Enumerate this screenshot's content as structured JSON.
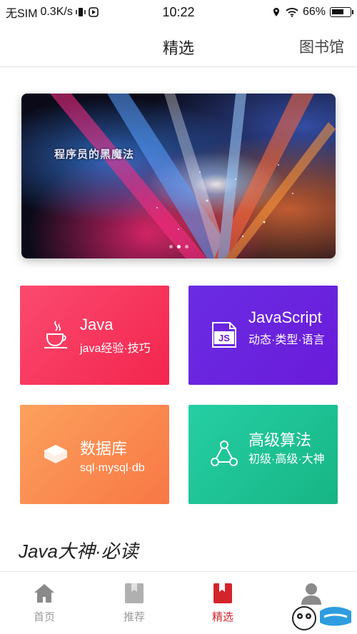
{
  "status_bar": {
    "carrier": "无SIM",
    "speed": "0.3K/s",
    "time": "10:22",
    "battery": "66%",
    "battery_level": 0.66
  },
  "header": {
    "title": "精选",
    "library_link": "图书馆"
  },
  "banner": {
    "text": "程序员的黑魔法",
    "slides": 3,
    "active_slide": 1
  },
  "categories": [
    {
      "name": "Java",
      "desc": "java经验·技巧",
      "icon": "java-cup-icon",
      "color": "#f3254e"
    },
    {
      "name": "JavaScript",
      "desc": "动态·类型·语言",
      "icon": "js-icon",
      "color": "#6a1bd9"
    },
    {
      "name": "数据库",
      "desc": "sql·mysql·db",
      "icon": "database-icon",
      "color": "#f87744"
    },
    {
      "name": "高级算法",
      "desc": "初级·高级·大神",
      "icon": "algorithm-icon",
      "color": "#17b585"
    }
  ],
  "section": {
    "title": "Java大神·必读"
  },
  "bottom_nav": [
    {
      "label": "首页",
      "icon": "home-icon",
      "active": false
    },
    {
      "label": "推荐",
      "icon": "bookmark-icon",
      "active": false
    },
    {
      "label": "精选",
      "icon": "book-icon",
      "active": true
    },
    {
      "label": "",
      "icon": "user-icon",
      "active": false
    }
  ],
  "colors": {
    "accent": "#d4242b",
    "inactive": "#999999"
  }
}
